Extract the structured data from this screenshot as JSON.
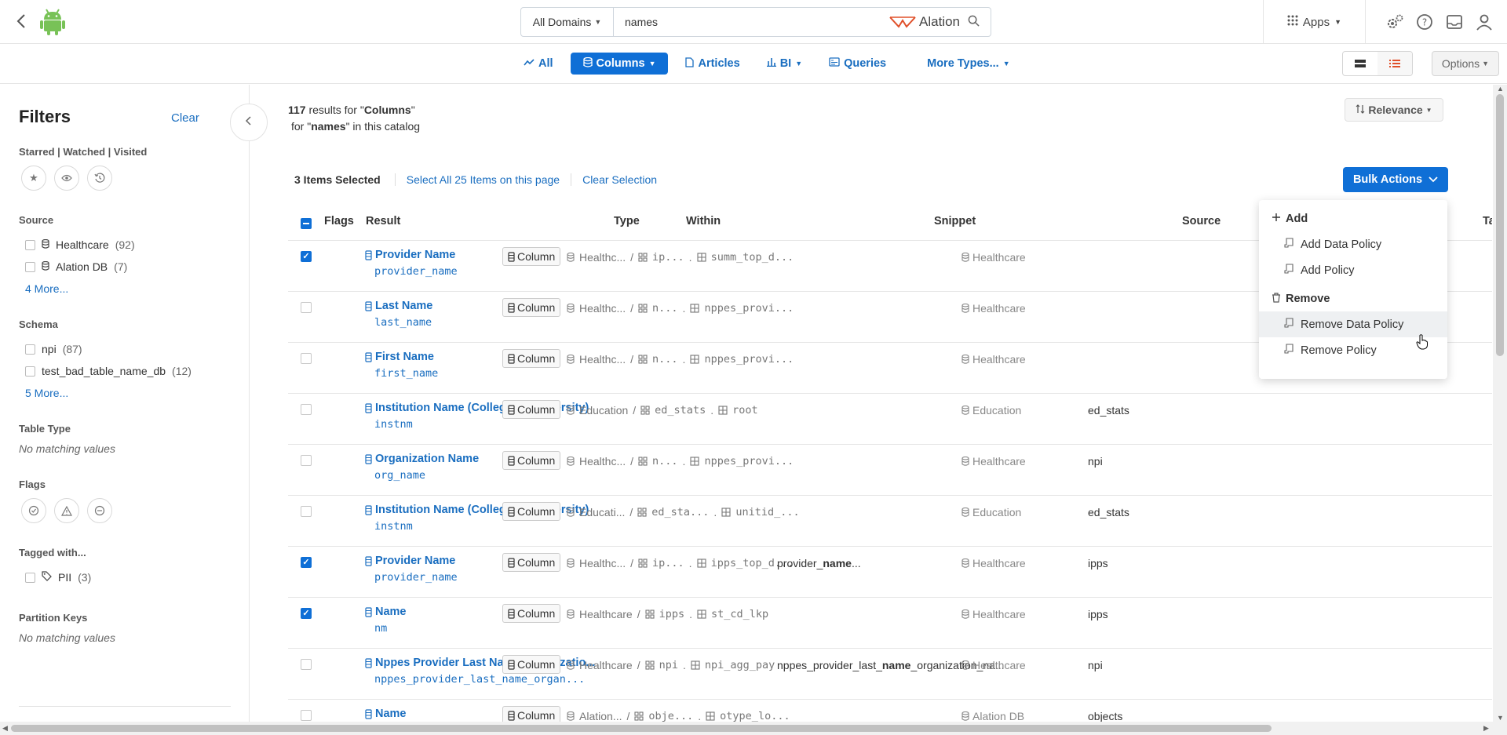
{
  "topbar": {
    "domain_select": "All Domains",
    "search_value": "names",
    "brand": "Alation",
    "apps_label": "Apps"
  },
  "type_tabs": [
    {
      "label": "All",
      "icon": "trend-icon"
    },
    {
      "label": "Columns",
      "icon": "database-icon",
      "active": true,
      "dropdown": true
    },
    {
      "label": "Articles",
      "icon": "doc-icon"
    },
    {
      "label": "BI",
      "icon": "bar-chart-icon",
      "dropdown": true
    },
    {
      "label": "Queries",
      "icon": "query-icon"
    },
    {
      "label": "More Types...",
      "dropdown": true
    }
  ],
  "options_label": "Options",
  "filters": {
    "title": "Filters",
    "clear": "Clear",
    "starred_label": "Starred | Watched | Visited",
    "source_label": "Source",
    "source_items": [
      {
        "name": "Healthcare",
        "count": "(92)"
      },
      {
        "name": "Alation DB",
        "count": "(7)"
      }
    ],
    "source_more": "4 More...",
    "schema_label": "Schema",
    "schema_items": [
      {
        "name": "npi",
        "count": "(87)"
      },
      {
        "name": "test_bad_table_name_db",
        "count": "(12)"
      }
    ],
    "schema_more": "5 More...",
    "table_type_label": "Table Type",
    "table_type_empty": "No matching values",
    "flags_label": "Flags",
    "tagged_label": "Tagged with...",
    "tagged_items": [
      {
        "name": "PII",
        "count": "(3)"
      }
    ],
    "partition_label": "Partition Keys",
    "partition_empty": "No matching values"
  },
  "results": {
    "count": "117",
    "text1": " results for \"",
    "type": "Columns",
    "text2": "\"",
    "text3": " for \"",
    "query": "names",
    "text4": "\" in this catalog",
    "sort_label": "Relevance",
    "selected_label": "3 Items Selected",
    "select_all": "Select All 25 Items on this page",
    "clear_selection": "Clear Selection",
    "bulk_actions": "Bulk Actions"
  },
  "table": {
    "headers": {
      "flags": "Flags",
      "result": "Result",
      "type": "Type",
      "within": "Within",
      "snippet": "Snippet",
      "source": "Source",
      "tags": "Ta"
    },
    "rows": [
      {
        "checked": true,
        "title": "Provider Name",
        "sub": "provider_name",
        "type": "Column",
        "w1": "Healthc...",
        "w2": "ip...",
        "w3": "summ_top_d...",
        "snippet_pre": "",
        "snippet_bold": "",
        "snippet_post": "",
        "source": "Healthcare",
        "tag": ""
      },
      {
        "checked": false,
        "title": "Last Name",
        "sub": "last_name",
        "type": "Column",
        "w1": "Healthc...",
        "w2": "n...",
        "w3": "nppes_provi...",
        "snippet_pre": "",
        "snippet_bold": "",
        "snippet_post": "",
        "source": "Healthcare",
        "tag": ""
      },
      {
        "checked": false,
        "title": "First Name",
        "sub": "first_name",
        "type": "Column",
        "w1": "Healthc...",
        "w2": "n...",
        "w3": "nppes_provi...",
        "snippet_pre": "",
        "snippet_bold": "",
        "snippet_post": "",
        "source": "Healthcare",
        "tag": ""
      },
      {
        "checked": false,
        "title": "Institution Name (College or University)",
        "sub": "instnm",
        "type": "Column",
        "w1": "Education",
        "w2": "ed_stats",
        "w3": "root",
        "snippet_pre": "",
        "snippet_bold": "",
        "snippet_post": "",
        "source": "Education",
        "tag": "ed_stats"
      },
      {
        "checked": false,
        "title": "Organization Name",
        "sub": "org_name",
        "type": "Column",
        "w1": "Healthc...",
        "w2": "n...",
        "w3": "nppes_provi...",
        "snippet_pre": "",
        "snippet_bold": "",
        "snippet_post": "",
        "source": "Healthcare",
        "tag": "npi"
      },
      {
        "checked": false,
        "title": "Institution Name (College or University)",
        "sub": "instnm",
        "type": "Column",
        "w1": "Educati...",
        "w2": "ed_sta...",
        "w3": "unitid_...",
        "snippet_pre": "",
        "snippet_bold": "",
        "snippet_post": "",
        "source": "Education",
        "tag": "ed_stats"
      },
      {
        "checked": true,
        "title": "Provider Name",
        "sub": "provider_name",
        "type": "Column",
        "w1": "Healthc...",
        "w2": "ip...",
        "w3": "ipps_top_d...",
        "snippet_pre": "provider_",
        "snippet_bold": "name",
        "snippet_post": "...",
        "source": "Healthcare",
        "tag": "ipps"
      },
      {
        "checked": true,
        "title": "Name",
        "sub": "nm",
        "type": "Column",
        "w1": "Healthcare",
        "w2": "ipps",
        "w3": "st_cd_lkp",
        "snippet_pre": "",
        "snippet_bold": "",
        "snippet_post": "",
        "source": "Healthcare",
        "tag": "ipps"
      },
      {
        "checked": false,
        "title": "Nppes Provider Last Name Organizatio...",
        "sub": "nppes_provider_last_name_organ...",
        "type": "Column",
        "w1": "Healthcare",
        "w2": "npi",
        "w3": "npi_agg_pay",
        "snippet_pre": "nppes_provider_last_",
        "snippet_bold": "name",
        "snippet_post": "_organization_na...",
        "source": "Healthcare",
        "tag": "npi"
      },
      {
        "checked": false,
        "title": "Name",
        "sub": "",
        "type": "Column",
        "w1": "Alation...",
        "w2": "obje...",
        "w3": "otype_lo...",
        "snippet_pre": "",
        "snippet_bold": "",
        "snippet_post": "",
        "source": "Alation DB",
        "tag": "objects"
      }
    ]
  },
  "bulk_menu": {
    "add_label": "Add",
    "add_items": [
      "Add Data Policy",
      "Add Policy"
    ],
    "remove_label": "Remove",
    "remove_items": [
      "Remove Data Policy",
      "Remove Policy"
    ]
  },
  "colors": {
    "accent": "#0f6fd6",
    "link": "#1a6ec0",
    "android_green": "#78c257"
  }
}
